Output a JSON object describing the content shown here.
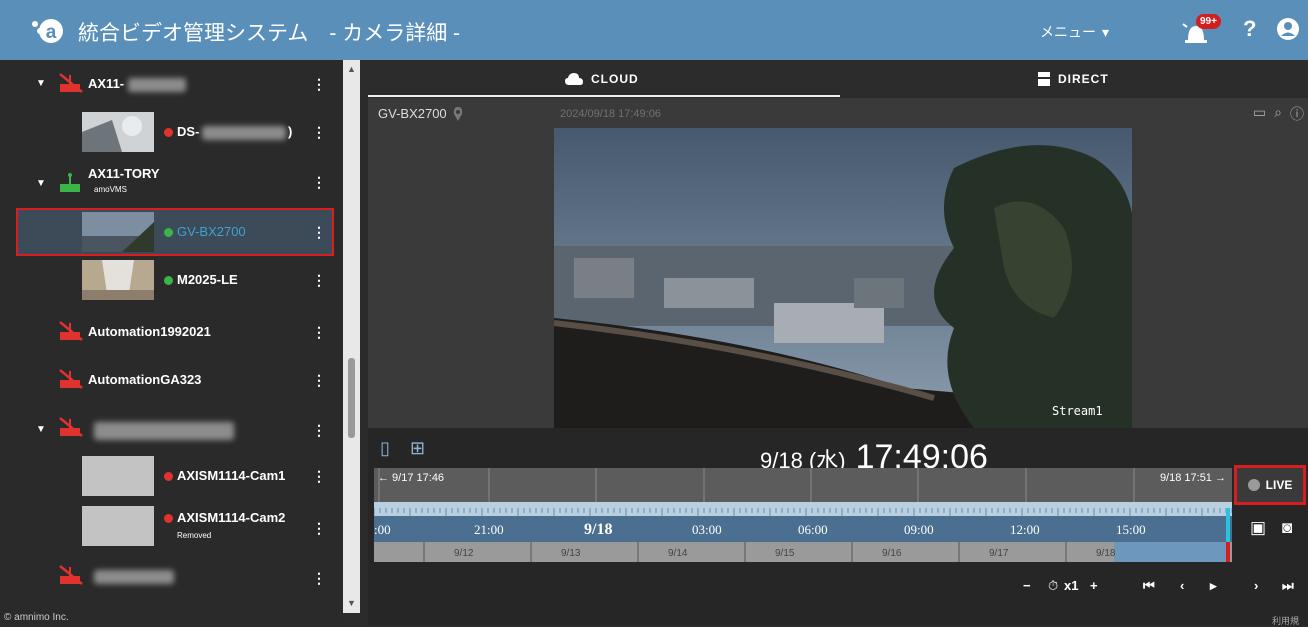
{
  "header": {
    "title": "統合ビデオ管理システム　- カメラ詳細 -",
    "menu_label": "メニュー",
    "alert_badge": "99+",
    "help_label": "?"
  },
  "sidebar": {
    "items": [
      {
        "label": "AX11-",
        "status": "offline",
        "type": "gateway"
      },
      {
        "label": "DS-",
        "suffix": ")",
        "status_color": "#e0332e",
        "type": "camera"
      },
      {
        "label": "AX11-TORY",
        "sub": "amoVMS",
        "status": "online",
        "type": "gateway"
      },
      {
        "label": "GV-BX2700",
        "status_color": "#3bb44a",
        "type": "camera",
        "selected": true
      },
      {
        "label": "M2025-LE",
        "status_color": "#3bb44a",
        "type": "camera"
      },
      {
        "label": "Automation1992021",
        "status": "offline",
        "type": "gateway"
      },
      {
        "label": "AutomationGA323",
        "status": "offline",
        "type": "gateway"
      },
      {
        "label": "",
        "status": "offline",
        "type": "gateway"
      },
      {
        "label": "AXISM1114-Cam1",
        "status_color": "#e0332e",
        "type": "camera"
      },
      {
        "label": "AXISM1114-Cam2",
        "sub": "Removed",
        "status_color": "#e0332e",
        "type": "camera"
      },
      {
        "label": "",
        "status": "offline",
        "type": "gateway"
      }
    ],
    "footer": "© amnimo Inc."
  },
  "tabs": {
    "cloud": "CLOUD",
    "direct": "DIRECT"
  },
  "video": {
    "camera_name": "GV-BX2700",
    "overlay_timestamp": "2024/09/18 17:49:06",
    "stream_label": "Stream1"
  },
  "timeline": {
    "date": "9/18 (水)",
    "time": "17:49:06",
    "range_start": "← 9/17 17:46",
    "range_end": "9/18 17:51 →",
    "hour_ticks": [
      ":00",
      "21:00",
      "9/18",
      "03:00",
      "06:00",
      "09:00",
      "12:00",
      "15:00"
    ],
    "day_ticks": [
      "9/12",
      "9/13",
      "9/14",
      "9/15",
      "9/16",
      "9/17",
      "9/18"
    ],
    "live_label": "LIVE",
    "speed": "x1",
    "corner_text": "利用規"
  }
}
